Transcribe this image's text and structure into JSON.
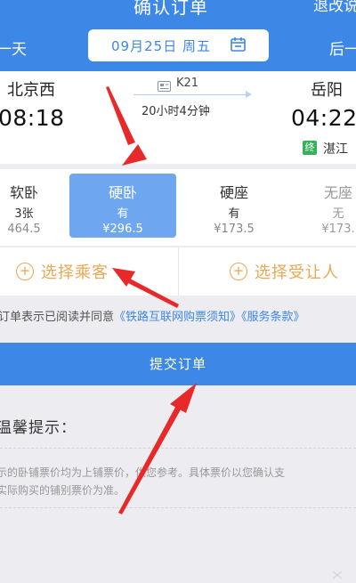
{
  "header": {
    "title": "确认订单",
    "right_action": "退改说",
    "prev_day": "一天",
    "next_day": "后一"
  },
  "date_selector": {
    "value": "09月25日 周五",
    "icon": "calendar-icon"
  },
  "train": {
    "departure_station": "北京西",
    "departure_time": "08:18",
    "number": "K21",
    "duration": "20小时4分钟",
    "arrival_station": "岳阳",
    "arrival_time": "04:22",
    "terminal_badge": "终",
    "terminal_station": "湛江"
  },
  "seats": [
    {
      "name": "软卧",
      "availability": "3张",
      "price": "464.5"
    },
    {
      "name": "硬卧",
      "availability": "有",
      "price": "¥296.5"
    },
    {
      "name": "硬座",
      "availability": "有",
      "price": "¥173.5"
    },
    {
      "name": "无座",
      "availability": "无",
      "price": "¥173."
    }
  ],
  "passengers": {
    "add_passenger": "选择乘客",
    "add_recipient": "选择受让人"
  },
  "agreement": {
    "prefix": "订单表示已阅读并同意",
    "link1": "《铁路互联网购票须知》",
    "link2": "《服务条款》"
  },
  "submit_label": "提交订单",
  "tips": {
    "title": "温馨提示：",
    "line1": "示的卧铺票价均为上铺票价，供您参考。具体票价以您确认支",
    "line2": "实际购买的铺别票价为准。"
  },
  "colors": {
    "primary": "#3d87e6",
    "selected_seat": "#6ea7ef",
    "accent_orange": "#e8a854",
    "annotation_red": "#e8292a"
  }
}
